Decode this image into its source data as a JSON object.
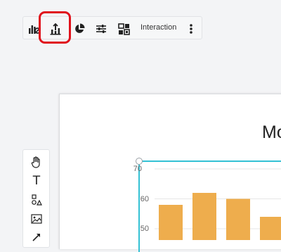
{
  "toolbar": {
    "items": [
      {
        "icon": "bar-chart-filter-icon"
      },
      {
        "icon": "bar-chart-upload-icon",
        "highlighted": true
      },
      {
        "icon": "pie-chart-icon"
      },
      {
        "icon": "sliders-icon"
      },
      {
        "icon": "layout-blocks-icon"
      }
    ],
    "interaction_label": "Interaction",
    "more_icon": "more-vertical-icon"
  },
  "tools": [
    {
      "icon": "hand-icon"
    },
    {
      "icon": "text-icon",
      "glyph": "T"
    },
    {
      "icon": "shapes-icon"
    },
    {
      "icon": "image-icon"
    },
    {
      "icon": "arrow-icon"
    }
  ],
  "chart_data": {
    "type": "bar",
    "title": "Mo",
    "yticks": [
      "70",
      "60",
      "50"
    ],
    "values": [
      58,
      62,
      60,
      54
    ],
    "ylim": [
      40,
      70
    ],
    "bar_color": "#eead4d"
  },
  "colors": {
    "highlight": "#e0121c",
    "selection": "#34c1d4"
  }
}
